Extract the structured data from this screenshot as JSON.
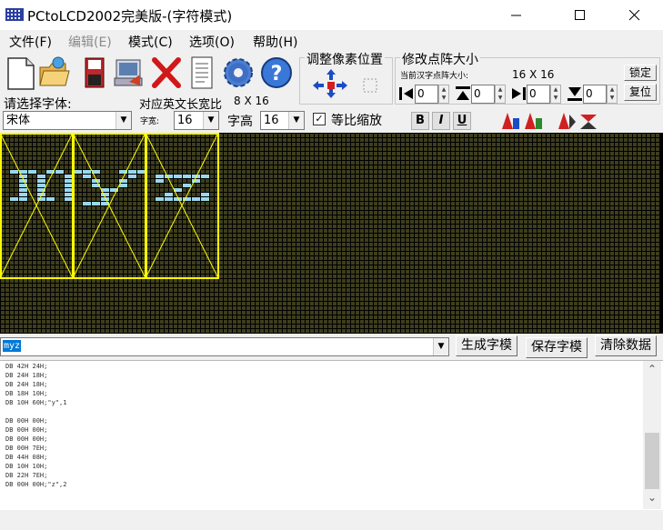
{
  "window": {
    "title": "PCtoLCD2002完美版-(字符模式)"
  },
  "menu": [
    {
      "label": "文件(F)",
      "enabled": true
    },
    {
      "label": "编辑(E)",
      "enabled": false
    },
    {
      "label": "模式(C)",
      "enabled": true
    },
    {
      "label": "选项(O)",
      "enabled": true
    },
    {
      "label": "帮助(H)",
      "enabled": true
    }
  ],
  "toolbar_icons": [
    "new-file-icon",
    "open-folder-icon",
    "save-disk-icon",
    "export-icon",
    "delete-x-icon",
    "notepad-icon",
    "gear-icon",
    "help-question-icon"
  ],
  "pixel_adjust": {
    "title": "调整像素位置"
  },
  "matrix_size": {
    "title": "修改点阵大小",
    "current_label": "当前汉字点阵大小:",
    "current_value": "16 X 16",
    "lock_label": "锁定",
    "reset_label": "复位",
    "spins": [
      "0",
      "0",
      "0",
      "0"
    ]
  },
  "font": {
    "select_label": "请选择字体:",
    "ratio_label": "对应英文长宽比",
    "ratio_value": "8 X 16",
    "font_value": "宋体",
    "width_label": "字宽:",
    "width_value": "16",
    "height_label": "字高",
    "height_value": "16",
    "scale_label": "等比缩放",
    "scale_checked": true,
    "bold": "B",
    "italic": "I",
    "underline": "U"
  },
  "input": {
    "text": "myz",
    "generate_label": "生成字模",
    "save_label": "保存字模",
    "clear_label": "清除数据"
  },
  "output_lines": [
    "DB 42H 24H;",
    "DB 24H 18H;",
    "DB 24H 18H;",
    "DB 18H 10H;",
    "DB 10H 60H;\"y\",1",
    "",
    "DB 00H 00H;",
    "DB 00H 00H;",
    "DB 00H 00H;",
    "DB 00H 7EH;",
    "DB 44H 08H;",
    "DB 10H 10H;",
    "DB 22H 7EH;",
    "DB 00H 00H;\"z\",2"
  ],
  "colors": {
    "matrix_off": "#3e3e1e",
    "matrix_on": "#9ad8ee",
    "guide": "#ffff00",
    "matrix_bg": "#000000"
  }
}
